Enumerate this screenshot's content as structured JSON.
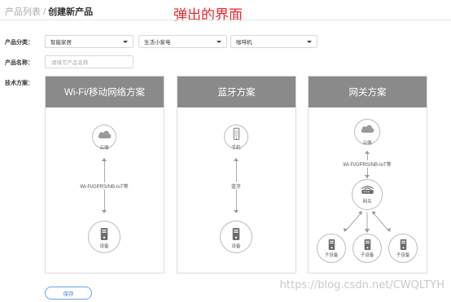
{
  "breadcrumb": {
    "parent": "产品列表",
    "sep": " / ",
    "current": "创建新产品"
  },
  "annotation": "弹出的界面",
  "form": {
    "category_label": "产品分类：",
    "category_1": "智能家居",
    "category_2": "生活小家电",
    "category_3": "咖啡机",
    "name_label": "产品名称：",
    "name_placeholder": "请填写产品名称",
    "tech_label": "技术方案："
  },
  "cards": {
    "wifi": {
      "title": "Wi-Fi/移动网络方案",
      "cloud": "云端",
      "link": "Wi-Fi/GPRS/NB-IoT等",
      "device": "设备"
    },
    "bt": {
      "title": "蓝牙方案",
      "phone": "手机",
      "link": "蓝牙",
      "device": "设备"
    },
    "gw": {
      "title": "网关方案",
      "cloud": "云端",
      "link": "Wi-Fi/GPRS/NB-IoT等",
      "gateway": "网关",
      "sub1": "子设备",
      "sub2": "子设备",
      "sub3": "子设备"
    }
  },
  "save_label": "保存",
  "watermark": "https://blog.csdn.net/CWQLTYH",
  "colors": {
    "annotation": "#e8262b",
    "card_header": "#8a8a8a",
    "save_border": "#6aa0e6"
  }
}
